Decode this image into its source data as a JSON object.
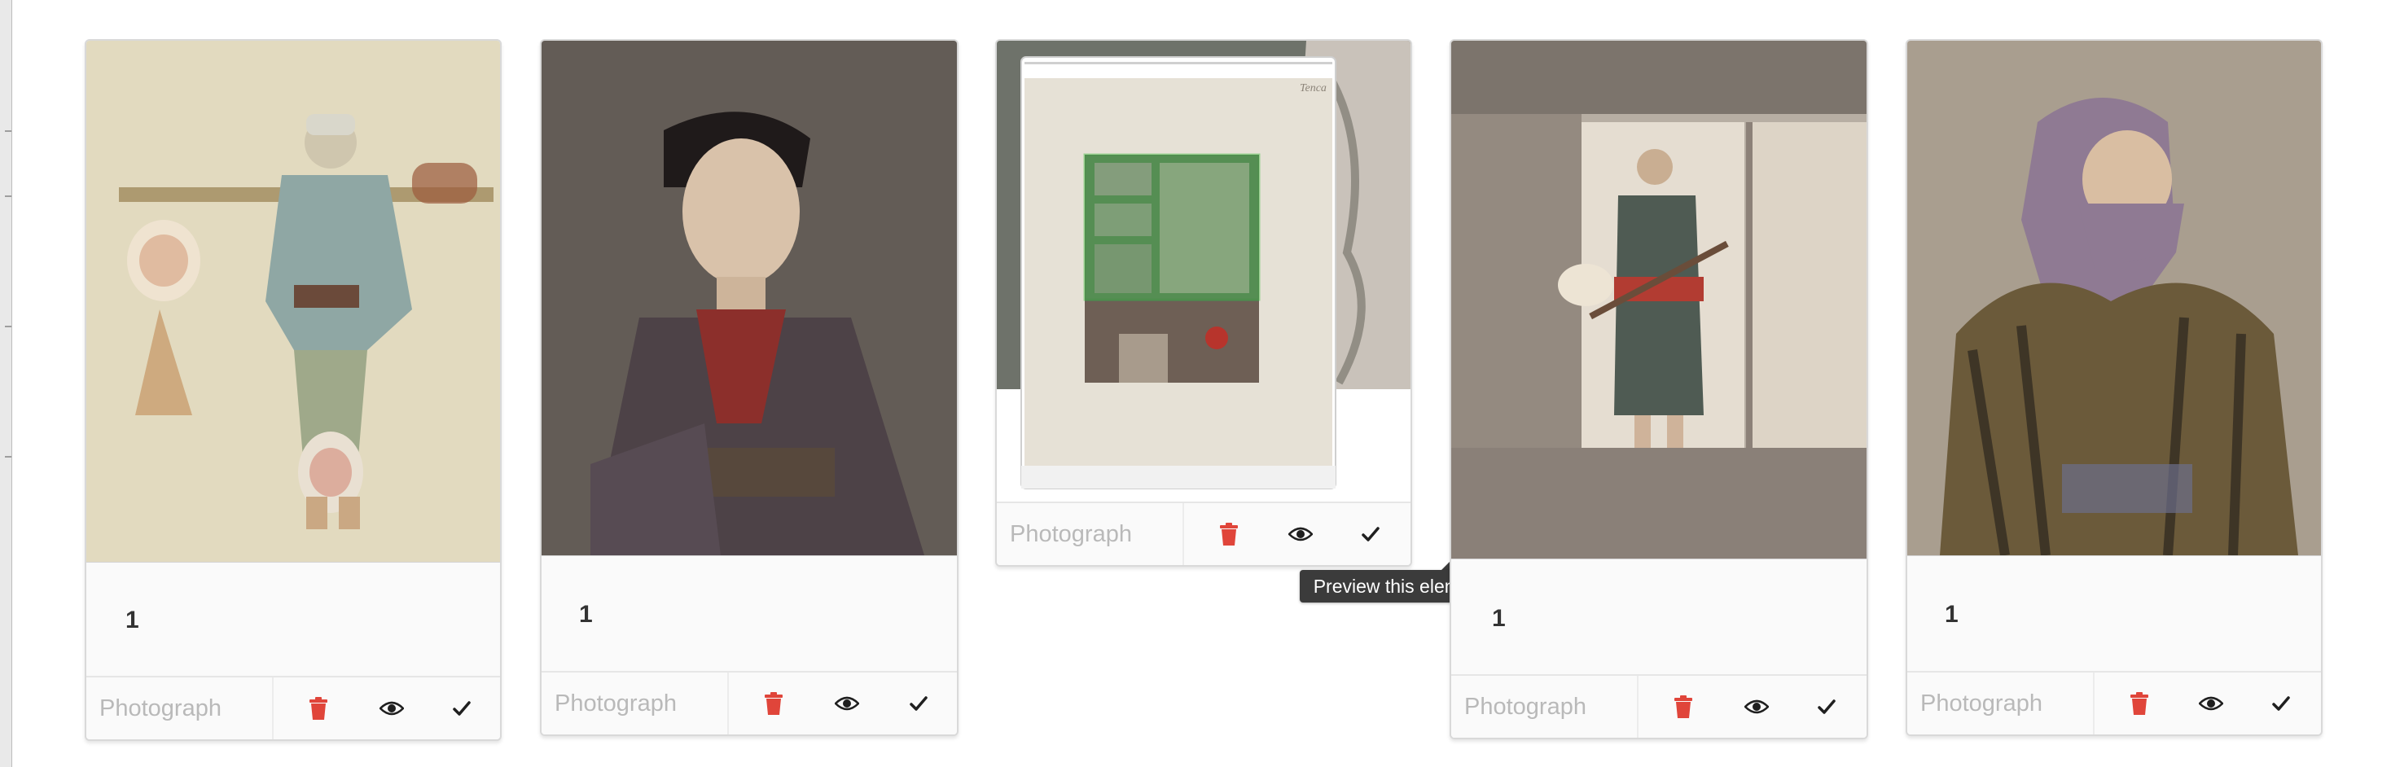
{
  "cards": [
    {
      "count": "1",
      "type_placeholder": "Photograph",
      "photo_tones": {
        "bg": "#e7e0c6",
        "subject": "#8fa3a0",
        "accent": "#c98b6b"
      },
      "icons": [
        "trash-icon",
        "eye-icon",
        "check-icon"
      ]
    },
    {
      "count": "1",
      "type_placeholder": "Photograph",
      "photo_tones": {
        "bg": "#6f6660",
        "subject": "#55474a",
        "accent": "#8c2d2a"
      },
      "icons": [
        "trash-icon",
        "eye-icon",
        "check-icon"
      ]
    },
    {
      "count": "",
      "type_placeholder": "Photograph",
      "photo_tones": {
        "bg": "#e2ddd2",
        "subject": "#6d7b6a",
        "accent": "#4cbf4c"
      },
      "icons": [
        "trash-icon",
        "eye-icon",
        "check-icon"
      ],
      "highlight_color": "#3fbf3f"
    },
    {
      "count": "1",
      "type_placeholder": "Photograph",
      "photo_tones": {
        "bg": "#b9b1a6",
        "subject": "#4f5a52",
        "accent": "#b23c32"
      },
      "icons": [
        "trash-icon",
        "eye-icon",
        "check-icon"
      ]
    },
    {
      "count": "1",
      "type_placeholder": "Photograph",
      "photo_tones": {
        "bg": "#b3a89a",
        "subject": "#8f7a93",
        "accent": "#6b5a3a"
      },
      "icons": [
        "trash-icon",
        "eye-icon",
        "check-icon"
      ]
    }
  ],
  "tooltip": {
    "text": "Preview this element on its image"
  },
  "colors": {
    "trash": "#e0453a",
    "icon_dark": "#1f1f1f",
    "placeholder": "#b9b9b9"
  }
}
